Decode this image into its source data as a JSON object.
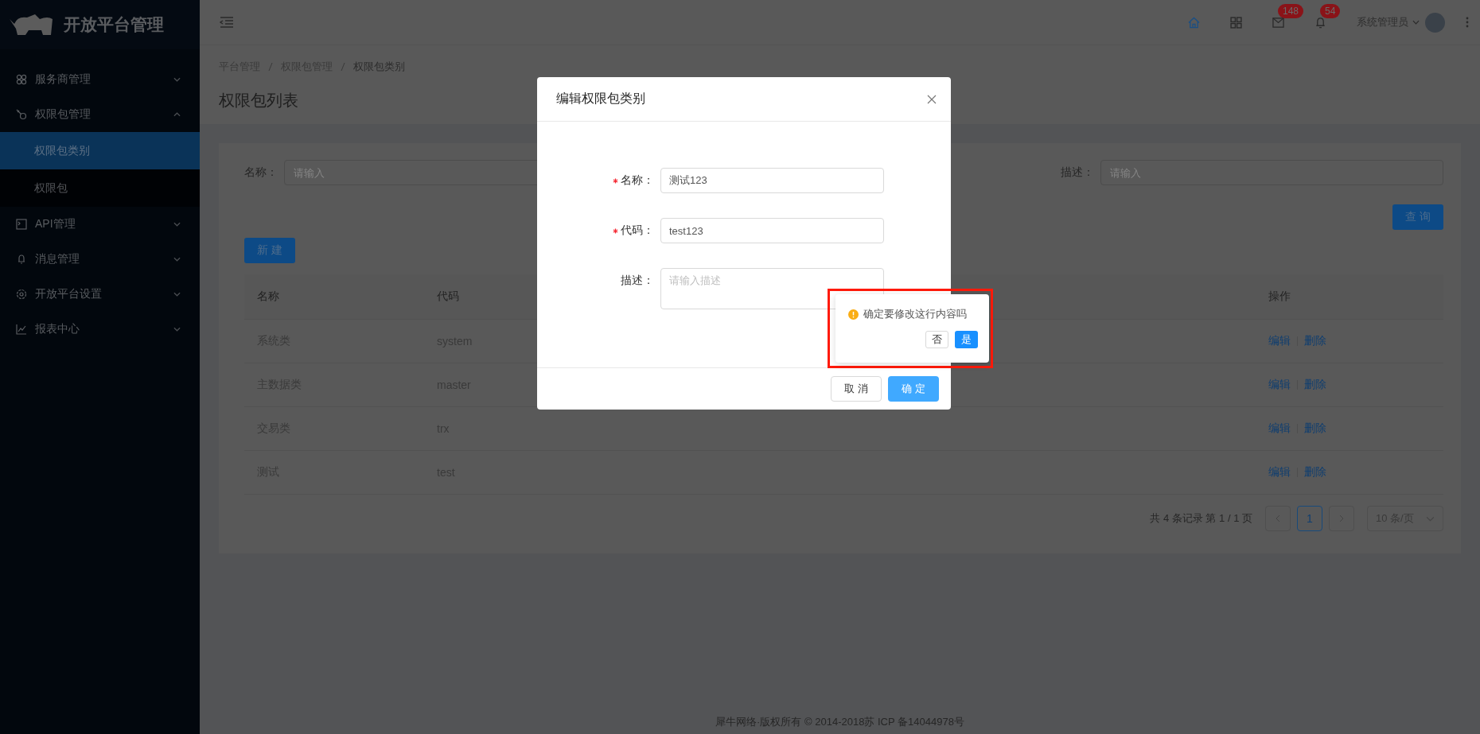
{
  "sidebar": {
    "logo": "开放平台管理",
    "items": [
      {
        "label": "服务商管理",
        "expanded": false
      },
      {
        "label": "权限包管理",
        "expanded": true,
        "children": [
          {
            "label": "权限包类别",
            "selected": true
          },
          {
            "label": "权限包",
            "selected": false
          }
        ]
      },
      {
        "label": "API管理",
        "expanded": false
      },
      {
        "label": "消息管理",
        "expanded": false
      },
      {
        "label": "开放平台设置",
        "expanded": false
      },
      {
        "label": "报表中心",
        "expanded": false
      }
    ]
  },
  "header": {
    "mail_badge": "148",
    "bell_badge": "54",
    "user": "系统管理员"
  },
  "breadcrumb": [
    "平台管理",
    "权限包管理",
    "权限包类别"
  ],
  "page_title": "权限包列表",
  "filters": [
    {
      "label": "名称：",
      "placeholder": "请输入"
    },
    {
      "label": "描述：",
      "placeholder": "请输入"
    }
  ],
  "query_button": "查 询",
  "new_button": "新 建",
  "table": {
    "columns": [
      "名称",
      "代码",
      "操作"
    ],
    "rows": [
      {
        "name": "系统类",
        "code": "system",
        "actions": [
          "编辑",
          "删除"
        ]
      },
      {
        "name": "主数据类",
        "code": "master",
        "actions": [
          "编辑",
          "删除"
        ]
      },
      {
        "name": "交易类",
        "code": "trx",
        "actions": [
          "编辑",
          "删除"
        ]
      },
      {
        "name": "测试",
        "code": "test",
        "actions": [
          "编辑",
          "删除"
        ]
      }
    ]
  },
  "pagination": {
    "summary": "共 4 条记录 第 1 / 1 页",
    "pages": [
      {
        "label": "1",
        "selected": true
      }
    ],
    "page_size": "10 条/页"
  },
  "footer": "犀牛网络·版权所有 © 2014-2018苏 ICP 备14044978号",
  "dialog": {
    "title": "编辑权限包类别",
    "fields": [
      {
        "kind": "input",
        "label": "名称：",
        "required": true,
        "value": "测试123"
      },
      {
        "kind": "input",
        "label": "代码：",
        "required": true,
        "value": "test123"
      },
      {
        "kind": "textarea",
        "label": "描述：",
        "required": false,
        "placeholder": "请输入描述"
      }
    ],
    "cancel": "取 消",
    "ok": "确 定"
  },
  "popconfirm": {
    "message": "确定要修改这行内容吗",
    "no": "否",
    "yes": "是"
  }
}
